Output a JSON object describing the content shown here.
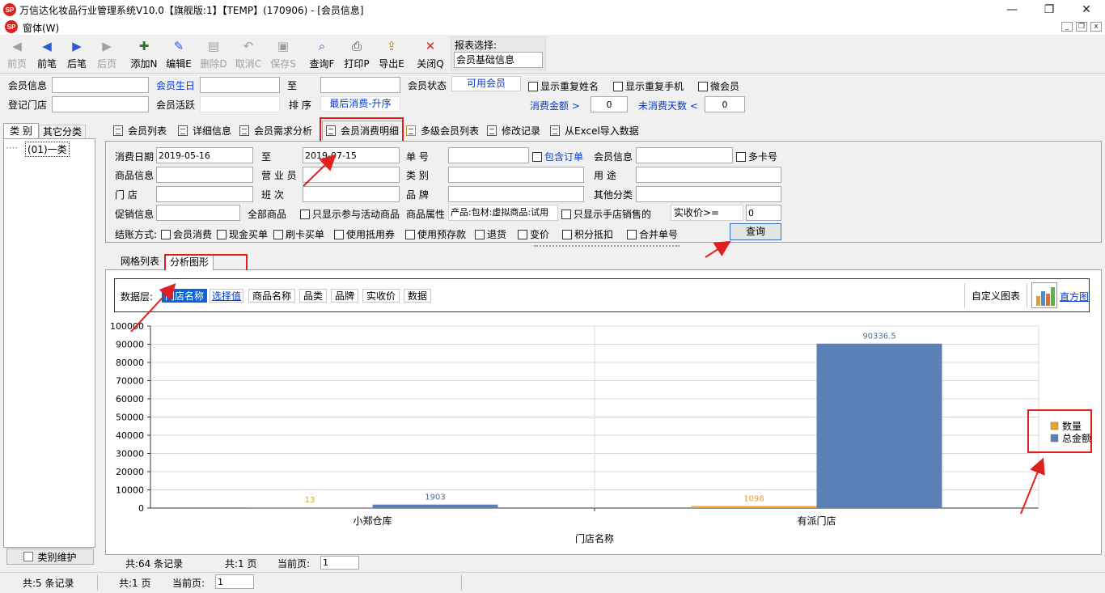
{
  "window": {
    "title": "万信达化妆品行业管理系统V10.0【旗舰版:1】【TEMP】(170906) - [会员信息]",
    "menu": "窗体(W)",
    "logo_text": "SP"
  },
  "toolbar": {
    "buttons": [
      {
        "label": "前页",
        "icon": "first-icon",
        "disabled": true
      },
      {
        "label": "前笔",
        "icon": "prev-icon",
        "disabled": false
      },
      {
        "label": "后笔",
        "icon": "next-icon",
        "disabled": false
      },
      {
        "label": "后页",
        "icon": "last-icon",
        "disabled": true
      },
      {
        "label": "添加N",
        "icon": "add-icon",
        "disabled": false
      },
      {
        "label": "编辑E",
        "icon": "edit-icon",
        "disabled": false
      },
      {
        "label": "删除D",
        "icon": "delete-icon",
        "disabled": true
      },
      {
        "label": "取消C",
        "icon": "undo-icon",
        "disabled": true
      },
      {
        "label": "保存S",
        "icon": "save-icon",
        "disabled": true
      },
      {
        "label": "查询F",
        "icon": "search-icon",
        "disabled": false
      },
      {
        "label": "打印P",
        "icon": "print-icon",
        "disabled": false
      },
      {
        "label": "导出E",
        "icon": "export-icon",
        "disabled": false
      },
      {
        "label": "关闭Q",
        "icon": "close-icon",
        "disabled": false
      }
    ],
    "report_label": "报表选择:",
    "report_value": "会员基础信息"
  },
  "filters": {
    "member_info": "会员信息",
    "birthday": "会员生日",
    "to": "至",
    "member_status": "会员状态",
    "status_value": "可用会员",
    "show_dup_name": "显示重复姓名",
    "show_dup_phone": "显示重复手机",
    "wechat_member": "微会员",
    "store": "登记门店",
    "activity": "会员活跃",
    "sort": "排  序",
    "sort_value": "最后消费-升序",
    "amount": "消费金额 >",
    "amount_value": "0",
    "days": "未消费天数 <",
    "days_value": "0"
  },
  "left": {
    "tabs": [
      "类 别",
      "其它分类"
    ],
    "tree_item": "(01)一类",
    "maintain_button": "类别维护"
  },
  "tabs": [
    "会员列表",
    "详细信息",
    "会员需求分析",
    "会员消费明细",
    "多级会员列表",
    "修改记录",
    "从Excel导入数据"
  ],
  "query": {
    "date_label": "消费日期",
    "date_from": "2019-05-16",
    "to": "至",
    "date_to": "2019-07-15",
    "order_no": "单      号",
    "include_order": "包含订单",
    "member_info": "会员信息",
    "multi_card": "多卡号",
    "goods_info": "商品信息",
    "salesman": "营 业 员",
    "category": "类      别",
    "usage": "用      途",
    "store": "门      店",
    "shift": "班      次",
    "brand": "品      牌",
    "other_class": "其他分类",
    "promo": "促销信息",
    "all_goods": "全部商品",
    "only_activity": "只显示参与活动商品",
    "goods_attr": "商品属性",
    "attr_value": "产品:包材:虚拟商品:试用",
    "only_store": "只显示手店销售的",
    "real_price": "实收价>=",
    "real_price_value": "0",
    "settle": "结账方式:",
    "settle_opts": [
      "会员消费",
      "现金买单",
      "刷卡买单",
      "使用抵用券",
      "使用预存款",
      "退货",
      "变价",
      "积分抵扣",
      "合并单号"
    ],
    "query_button": "查询"
  },
  "subtabs": [
    "网格列表",
    "分析图形"
  ],
  "datalayer": {
    "label": "数据层:",
    "tags": [
      "门店名称",
      "选择值",
      "商品名称",
      "品类",
      "品牌",
      "实收价",
      "数据"
    ],
    "custom_chart": "自定义图表",
    "histogram": "直方图"
  },
  "chart_data": {
    "type": "bar",
    "categories": [
      "小郑仓库",
      "有派门店"
    ],
    "series": [
      {
        "name": "数量",
        "values": [
          13,
          1098
        ],
        "color": "#f0a030"
      },
      {
        "name": "总金额",
        "values": [
          1903,
          90336.5
        ],
        "color": "#5b80b5"
      }
    ],
    "value_labels": [
      [
        "13",
        "1098"
      ],
      [
        "1903",
        "90336.5"
      ]
    ],
    "xlabel": "门店名称",
    "ylim": [
      0,
      100000
    ],
    "yticks": [
      "0",
      "10000",
      "20000",
      "30000",
      "40000",
      "50000",
      "60000",
      "70000",
      "80000",
      "90000",
      "100000"
    ],
    "legend": "right",
    "grid": true
  },
  "status": {
    "inner_total": "共:64 条记录",
    "inner_pages": "共:1 页",
    "inner_cur_label": "当前页:",
    "inner_cur": "1",
    "outer_total": "共:5 条记录",
    "outer_pages": "共:1 页",
    "outer_cur_label": "当前页:",
    "outer_cur": "1"
  }
}
